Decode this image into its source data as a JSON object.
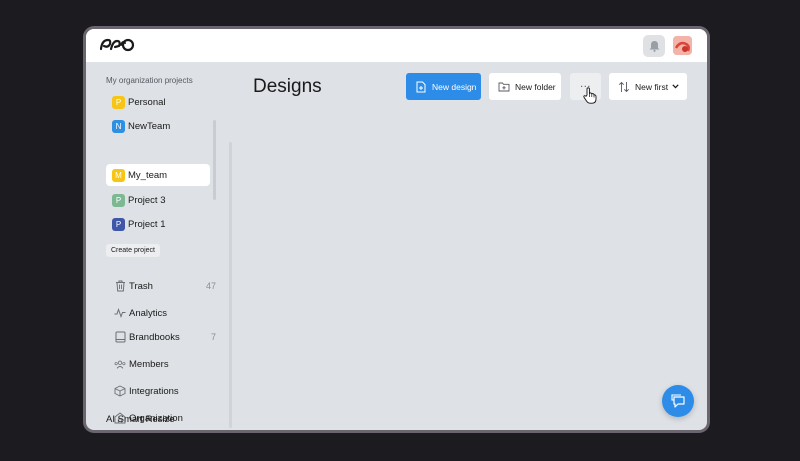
{
  "sidebar": {
    "section_title": "My organization projects",
    "projects": [
      {
        "initial": "P",
        "label": "Personal",
        "color": "#f7c515"
      },
      {
        "initial": "N",
        "label": "NewTeam",
        "color": "#2f8fe2"
      },
      {
        "initial": "M",
        "label": "My_team",
        "color": "#f7c515"
      },
      {
        "initial": "P",
        "label": "Project 3",
        "color": "#7cb992"
      },
      {
        "initial": "P",
        "label": "Project 1",
        "color": "#3e57a8"
      }
    ],
    "create_project": "Create project",
    "nav": [
      {
        "label": "Trash",
        "count": "47",
        "icon": "trash-icon"
      },
      {
        "label": "Analytics",
        "count": "",
        "icon": "analytics-icon"
      },
      {
        "label": "Brandbooks",
        "count": "7",
        "icon": "book-icon"
      },
      {
        "label": "Members",
        "count": "",
        "icon": "members-icon"
      },
      {
        "label": "Integrations",
        "count": "",
        "icon": "cube-icon"
      },
      {
        "label": "Organization",
        "count": "",
        "icon": "house-icon"
      }
    ],
    "ai_resize": "AI Smart Resize"
  },
  "main": {
    "title": "Designs",
    "new_design": "New design",
    "new_folder": "New folder",
    "more": "...",
    "sort": "New first"
  },
  "colors": {
    "accent": "#2d8ce8",
    "background": "#dee1e5"
  }
}
